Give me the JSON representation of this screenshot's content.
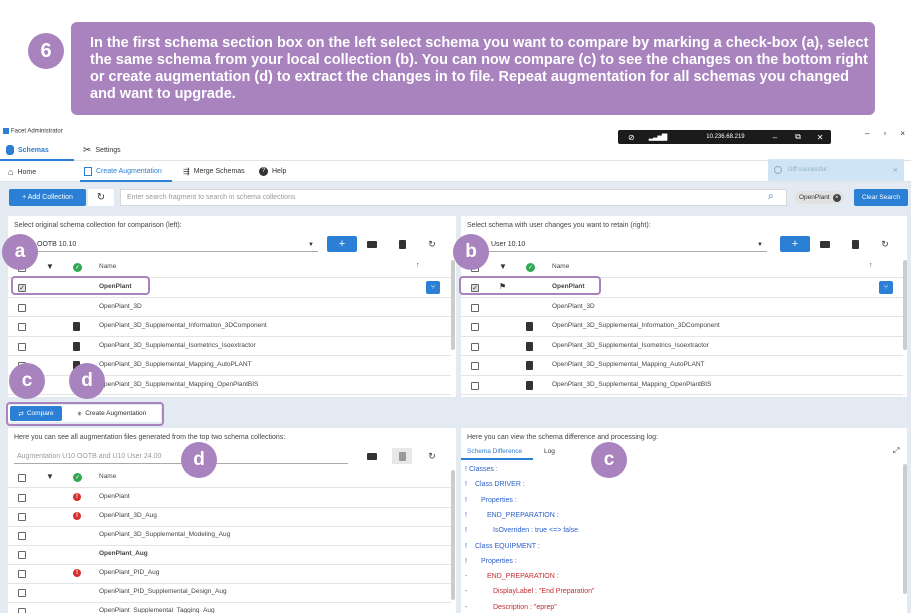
{
  "banner": {
    "step": "6",
    "text": "In the first schema section box on the left select schema you want to compare by marking a check-box (a), select the same schema from your local collection (b). You can now compare (c) to see the changes on the bottom right or create augmentation (d) to extract the changes in to file. Repeat augmentation for all schemas you changed and want to upgrade."
  },
  "window": {
    "title": "Facet Administrator",
    "minimize": "–",
    "maximize": "▫",
    "close": "×"
  },
  "remote_bar": {
    "ip": "10.236.68.219",
    "minimize": "–",
    "restore": "⧉",
    "close": "✕"
  },
  "main_tabs": {
    "schemas": "Schemas",
    "settings": "Settings"
  },
  "sub_nav": {
    "home": "Home",
    "create_augmentation": "Create Augmentation",
    "merge_schemas": "Merge Schemas",
    "help": "Help"
  },
  "toast": {
    "text": "Diff successful",
    "close": "×"
  },
  "search": {
    "add_collection": "+ Add Collection",
    "placeholder": "Enter search fragment to search in schema collections",
    "chip": "OpenPlant",
    "clear": "Clear Search"
  },
  "left_panel": {
    "caption": "Select original schema collection for comparison (left):",
    "selected_collection": "OOTB 10.10",
    "col_name": "Name",
    "rows": [
      {
        "name": "OpenPlant",
        "checked": true,
        "bold": true,
        "doc": false
      },
      {
        "name": "OpenPlant_3D",
        "checked": false,
        "bold": false,
        "doc": false
      },
      {
        "name": "OpenPlant_3D_Supplemental_Information_3DComponent",
        "checked": false,
        "bold": false,
        "doc": true
      },
      {
        "name": "OpenPlant_3D_Supplemental_Isometrics_Isoextractor",
        "checked": false,
        "bold": false,
        "doc": true
      },
      {
        "name": "OpenPlant_3D_Supplemental_Mapping_AutoPLANT",
        "checked": false,
        "bold": false,
        "doc": true
      },
      {
        "name": "OpenPlant_3D_Supplemental_Mapping_OpenPlantBIS",
        "checked": false,
        "bold": false,
        "doc": true
      }
    ]
  },
  "right_panel": {
    "caption": "Select schema with user changes you want to retain (right):",
    "selected_collection": "User 10.10",
    "col_name": "Name",
    "rows": [
      {
        "name": "OpenPlant",
        "checked": true,
        "bold": true,
        "doc": false
      },
      {
        "name": "OpenPlant_3D",
        "checked": false,
        "bold": false,
        "doc": false
      },
      {
        "name": "OpenPlant_3D_Supplemental_Information_3DComponent",
        "checked": false,
        "bold": false,
        "doc": true
      },
      {
        "name": "OpenPlant_3D_Supplemental_Isometrics_Isoextractor",
        "checked": false,
        "bold": false,
        "doc": true
      },
      {
        "name": "OpenPlant_3D_Supplemental_Mapping_AutoPLANT",
        "checked": false,
        "bold": false,
        "doc": true
      },
      {
        "name": "OpenPlant_3D_Supplemental_Mapping_OpenPlantBIS",
        "checked": false,
        "bold": false,
        "doc": true
      }
    ]
  },
  "actions": {
    "compare": "Compare",
    "create_augmentation": "Create Augmentation"
  },
  "aug_panel": {
    "caption": "Here you can see all augmentation files generated from the top two schema collections:",
    "input_placeholder": "Augmentation U10 OOTB and U10 User 24.00",
    "col_name": "Name",
    "rows": [
      {
        "name": "OpenPlant",
        "error": true,
        "bold": false
      },
      {
        "name": "OpenPlant_3D_Aug",
        "error": true,
        "bold": false
      },
      {
        "name": "OpenPlant_3D_Supplemental_Modeling_Aug",
        "error": false,
        "bold": false
      },
      {
        "name": "OpenPlant_Aug",
        "error": false,
        "bold": true
      },
      {
        "name": "OpenPlant_PID_Aug",
        "error": true,
        "bold": false
      },
      {
        "name": "OpenPlant_PID_Supplemental_Design_Aug",
        "error": false,
        "bold": false
      },
      {
        "name": "OpenPlant_Supplemental_Tagging_Aug",
        "error": false,
        "bold": false
      }
    ]
  },
  "diff_panel": {
    "caption": "Here you can view the schema difference and processing log:",
    "tab_diff": "Schema Difference",
    "tab_log": "Log",
    "lines": [
      {
        "marker": "!",
        "text": "Classes :",
        "indent": 0,
        "color": "#2a5fc9"
      },
      {
        "marker": "!",
        "text": "Class DRIVER :",
        "indent": 1,
        "color": "#2a5fc9"
      },
      {
        "marker": "!",
        "text": "Properties :",
        "indent": 2,
        "color": "#2a5fc9"
      },
      {
        "marker": "!",
        "text": "END_PREPARATION :",
        "indent": 3,
        "color": "#2a5fc9"
      },
      {
        "marker": "!",
        "text": "IsOverriden : true <=> false",
        "indent": 4,
        "color": "#2a5fc9"
      },
      {
        "marker": "!",
        "text": "Class EQUIPMENT :",
        "indent": 1,
        "color": "#2a5fc9"
      },
      {
        "marker": "!",
        "text": "Properties :",
        "indent": 2,
        "color": "#2a5fc9"
      },
      {
        "marker": "-",
        "text": "END_PREPARATION :",
        "indent": 3,
        "color": "#c22d2d"
      },
      {
        "marker": "-",
        "text": "DisplayLabel : \"End Preparation\"",
        "indent": 4,
        "color": "#c22d2d"
      },
      {
        "marker": "-",
        "text": "Description : \"eprep\"",
        "indent": 4,
        "color": "#c22d2d"
      }
    ]
  },
  "annotations": {
    "a": "a",
    "b": "b",
    "c": "c",
    "d": "d"
  },
  "colors": {
    "accent": "#2b7fd4",
    "annotation": "#a883be",
    "error": "#d62f2f",
    "ok": "#2fa84f"
  }
}
